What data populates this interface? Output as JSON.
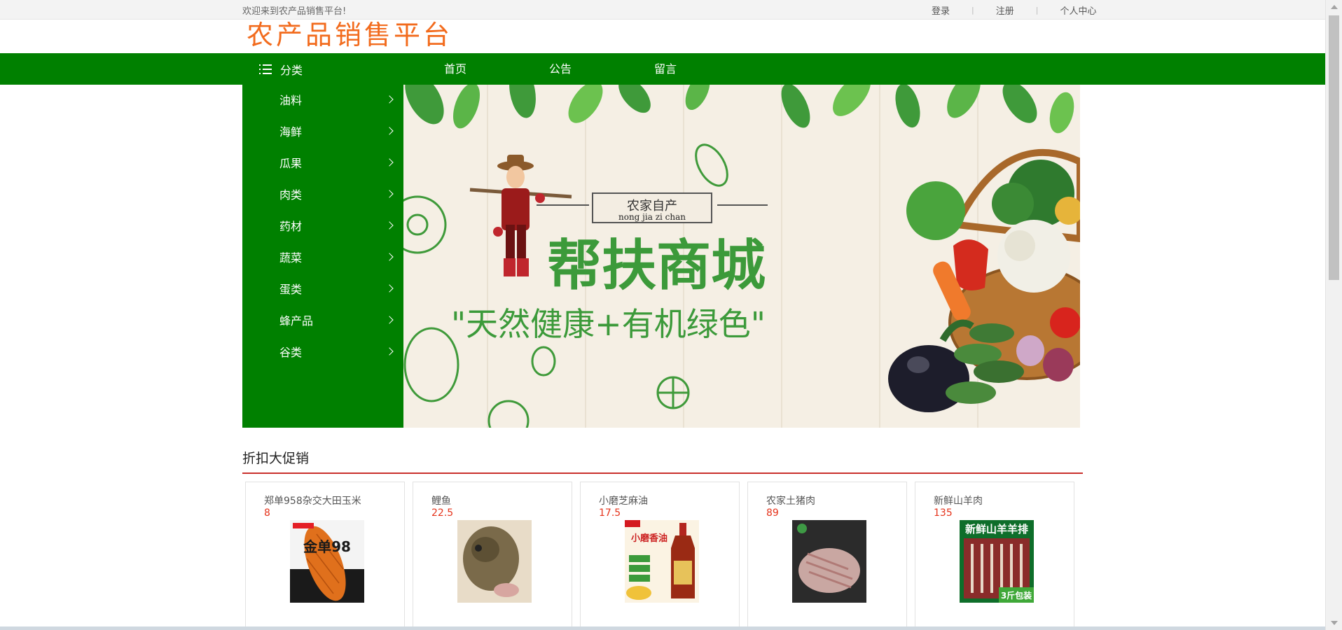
{
  "topbar": {
    "welcome": "欢迎来到农产品销售平台!",
    "login": "登录",
    "register": "注册",
    "profile": "个人中心"
  },
  "logo": {
    "text": "农产品销售平台"
  },
  "nav": {
    "category_label": "分类",
    "links": [
      "首页",
      "公告",
      "留言"
    ]
  },
  "categories": [
    "油料",
    "海鲜",
    "瓜果",
    "肉类",
    "药材",
    "蔬菜",
    "蛋类",
    "蜂产品",
    "谷类"
  ],
  "banner": {
    "tag": "农家自产",
    "tag_pinyin": "nong jia zi chan",
    "headline": "帮扶商城",
    "slogan": "\"天然健康+有机绿色\""
  },
  "promo": {
    "title": "折扣大促销",
    "products": [
      {
        "name": "郑单958杂交大田玉米",
        "price": "8",
        "image_text": "金单98",
        "icon": "corn-seed-package-image"
      },
      {
        "name": "鲤鱼",
        "price": "22.5",
        "image_text": "",
        "icon": "carp-fish-image"
      },
      {
        "name": "小磨芝麻油",
        "price": "17.5",
        "image_text": "小磨香油",
        "icon": "sesame-oil-bottle-image"
      },
      {
        "name": "农家土猪肉",
        "price": "89",
        "image_text": "",
        "icon": "pork-meat-image"
      },
      {
        "name": "新鲜山羊肉",
        "price": "135",
        "image_text": "新鲜山羊羊排",
        "image_badge": "3斤包装",
        "icon": "lamb-ribs-image"
      }
    ]
  },
  "colors": {
    "brand_green": "#008000",
    "logo_orange": "#f26b1d",
    "price_red": "#e5331b",
    "section_line": "#c9302c"
  }
}
